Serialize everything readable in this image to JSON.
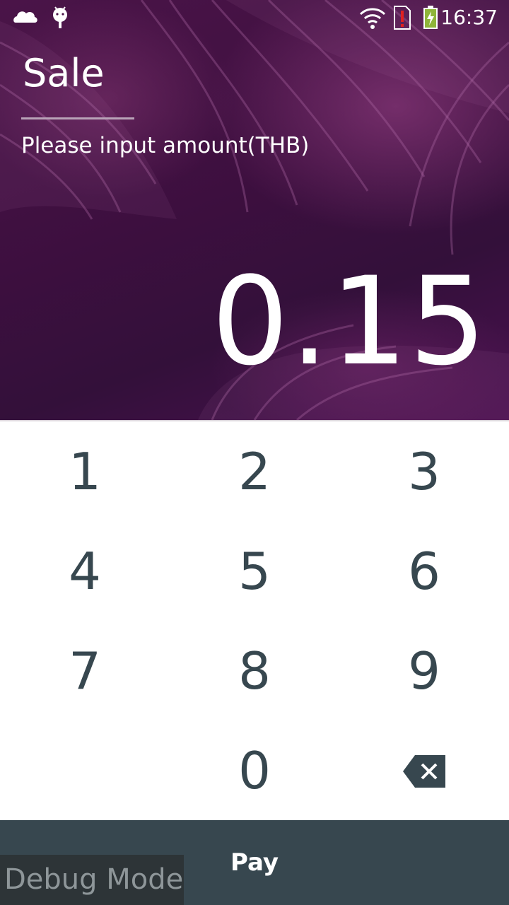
{
  "status_bar": {
    "time": "16:37",
    "left_icons": [
      "cloud-car-icon",
      "android-icon"
    ],
    "right_icons": [
      "wifi-icon",
      "sim-alert-icon",
      "battery-charging-icon"
    ]
  },
  "header": {
    "title": "Sale",
    "subtitle": "Please input amount(THB)"
  },
  "amount": {
    "value": "0.15"
  },
  "keypad": {
    "keys": [
      "1",
      "2",
      "3",
      "4",
      "5",
      "6",
      "7",
      "8",
      "9",
      "0"
    ],
    "backspace_icon": "backspace-icon"
  },
  "footer": {
    "pay_label": "Pay",
    "debug_label": "Debug Mode"
  },
  "colors": {
    "hero_purple": "#3d0f3f",
    "key_text": "#37474f",
    "pay_bar": "#37474f",
    "debug_bg": "#2d3437"
  }
}
